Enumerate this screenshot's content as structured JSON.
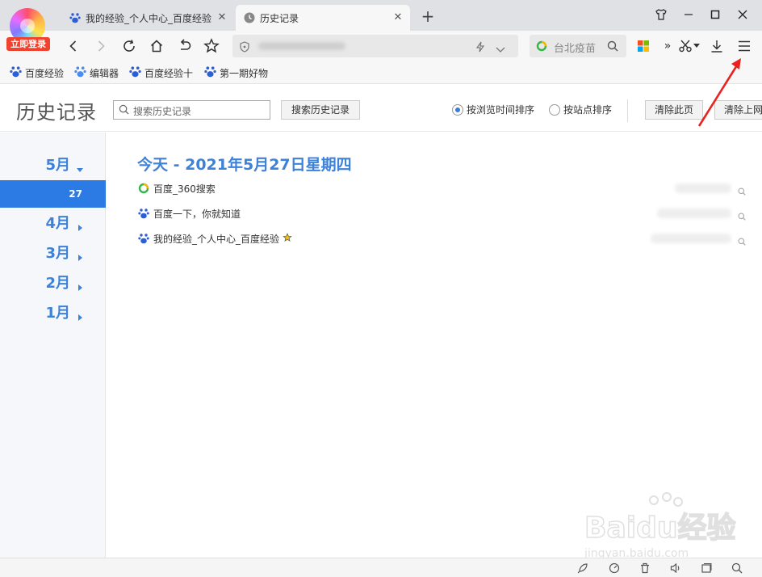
{
  "browser": {
    "login_badge": "立即登录",
    "tabs": [
      {
        "title": "我的经验_个人中心_百度经验",
        "active": false
      },
      {
        "title": "历史记录",
        "active": true
      }
    ],
    "new_tab_label": "+",
    "search_box_text": "台北疫苗",
    "bookmarks": [
      "百度经验",
      "编辑器",
      "百度经验十",
      "第一期好物"
    ]
  },
  "history": {
    "title": "历史记录",
    "search_placeholder": "搜索历史记录",
    "search_button": "搜索历史记录",
    "sort_options": [
      {
        "label": "按浏览时间排序",
        "selected": true
      },
      {
        "label": "按站点排序",
        "selected": false
      }
    ],
    "clear_page_button": "清除此页",
    "clear_previous_button": "清除上网"
  },
  "sidebar": {
    "months": [
      "5月",
      "4月",
      "3月",
      "2月",
      "1月"
    ],
    "selected_day": "27"
  },
  "content": {
    "date_heading": "今天 - 2021年5月27日星期四",
    "entries": [
      {
        "title": "百度_360搜索",
        "icon": "360-search-icon"
      },
      {
        "title": "百度一下，你就知道",
        "icon": "baidu-paw-icon"
      },
      {
        "title": "我的经验_个人中心_百度经验",
        "icon": "baidu-paw-icon",
        "starred": true
      }
    ]
  },
  "watermark": {
    "brand": "Baidu经验",
    "url": "jingyan.baidu.com"
  },
  "colors": {
    "accent_blue": "#3d82d9",
    "selected_day_bg": "#2c7be5",
    "login_red": "#f0432f",
    "annotation_arrow": "#e8231f"
  }
}
